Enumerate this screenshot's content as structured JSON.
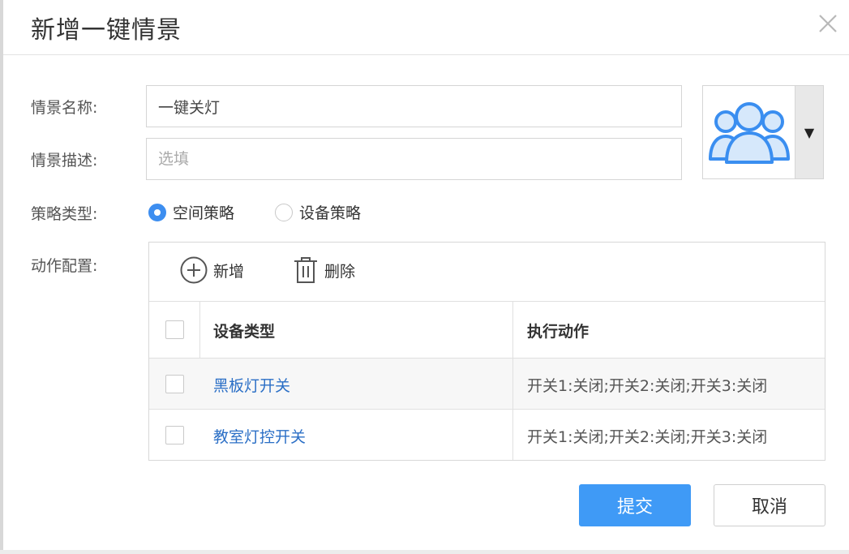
{
  "dialog": {
    "title": "新增一键情景"
  },
  "form": {
    "name_label": "情景名称:",
    "name_value": "一键关灯",
    "desc_label": "情景描述:",
    "desc_placeholder": "选填",
    "strategy_label": "策略类型:",
    "strategy_options": [
      {
        "label": "空间策略",
        "checked": true
      },
      {
        "label": "设备策略",
        "checked": false
      }
    ],
    "action_label": "动作配置:",
    "avatar_icon": "users-group-icon"
  },
  "actions": {
    "add_label": "新增",
    "delete_label": "删除",
    "columns": [
      "设备类型",
      "执行动作"
    ],
    "rows": [
      {
        "device": "黑板灯开关",
        "action": "开关1:关闭;开关2:关闭;开关3:关闭"
      },
      {
        "device": "教室灯控开关",
        "action": "开关1:关闭;开关2:关闭;开关3:关闭"
      }
    ]
  },
  "footer": {
    "submit_label": "提交",
    "cancel_label": "取消"
  },
  "colors": {
    "accent": "#3f9af6",
    "link": "#2b6fc6"
  }
}
